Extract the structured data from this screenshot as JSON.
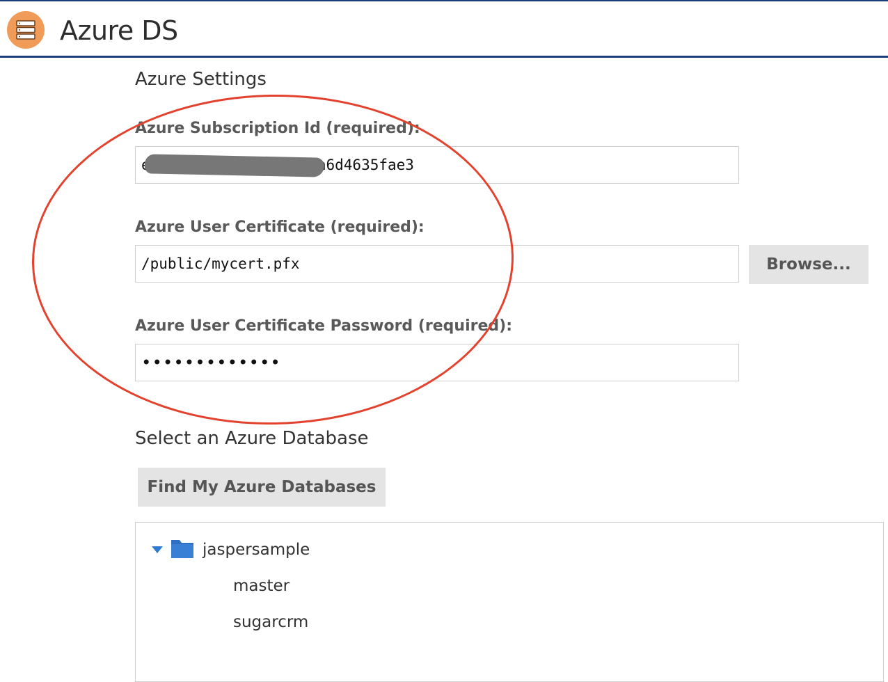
{
  "header": {
    "title": "Azure DS",
    "logo_icon": "database-server-icon",
    "accent_color": "#1c3d7a",
    "logo_color": "#f09b58"
  },
  "azure_settings": {
    "title": "Azure Settings",
    "subscription": {
      "label": "Azure Subscription Id (required):",
      "value": "e2*************5e8-0a6d4635fae3"
    },
    "certificate": {
      "label": "Azure User Certificate (required):",
      "value": "/public/mycert.pfx",
      "browse_label": "Browse..."
    },
    "password": {
      "label": "Azure User Certificate Password (required):",
      "value": "•••••••••••••"
    }
  },
  "database": {
    "title": "Select an Azure Database",
    "find_button_label": "Find My Azure Databases",
    "tree": {
      "server": "jaspersample",
      "databases": [
        "master",
        "sugarcrm"
      ]
    }
  },
  "annotation": {
    "circle_color": "#e3432e"
  }
}
